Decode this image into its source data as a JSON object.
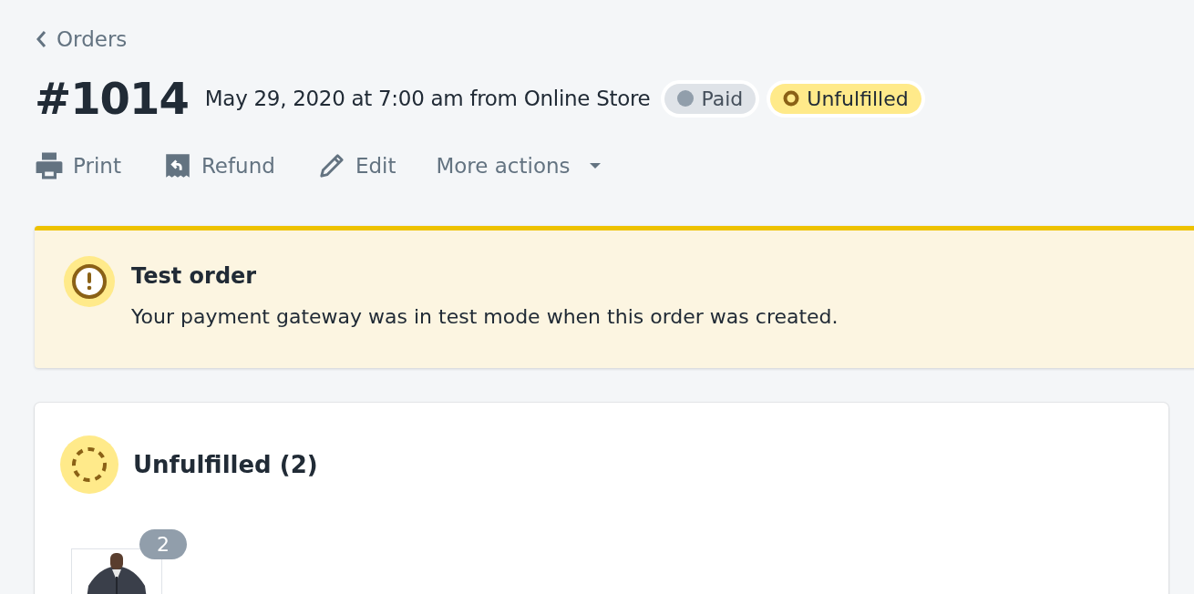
{
  "breadcrumb": {
    "label": "Orders"
  },
  "header": {
    "title": "#1014",
    "subtitle": "May 29, 2020 at 7:00 am from Online Store",
    "badges": [
      {
        "label": "Paid",
        "kind": "payment"
      },
      {
        "label": "Unfulfilled",
        "kind": "fulfillment"
      }
    ]
  },
  "actions": [
    {
      "label": "Print",
      "kind": "print"
    },
    {
      "label": "Refund",
      "kind": "refund"
    },
    {
      "label": "Edit",
      "kind": "edit"
    },
    {
      "label": "More actions",
      "kind": "menu"
    }
  ],
  "banner": {
    "title": "Test order",
    "message": "Your payment gateway was in test mode when this order was created."
  },
  "fulfillment_card": {
    "title": "Unfulfilled (2)",
    "items": [
      {
        "quantity": "2"
      }
    ]
  }
}
